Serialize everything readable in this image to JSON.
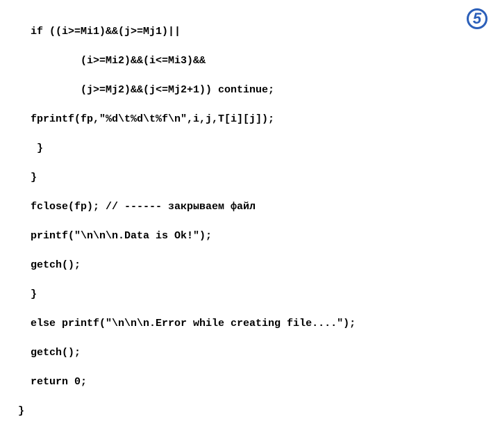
{
  "badge": {
    "number": "5"
  },
  "code": {
    "l1": "if ((i>=Mi1)&&(j>=Mj1)||",
    "l2": "    (i>=Mi2)&&(i<=Mi3)&&",
    "l3": "    (j>=Mj2)&&(j<=Mj2+1)) continue;",
    "l4": "fprintf(fp,\"%d\\t%d\\t%f\\n\",i,j,T[i][j]);",
    "l5": " }",
    "l6": "}",
    "l7": "fclose(fp); // ------ закрываем файл",
    "l8": "printf(\"\\n\\n\\n.Data is Ok!\");",
    "l9": "getch();",
    "l10": "}",
    "l11": "else printf(\"\\n\\n\\n.Error while creating file....\");",
    "l12": "getch();",
    "l13": "return 0;",
    "l14": "}"
  }
}
